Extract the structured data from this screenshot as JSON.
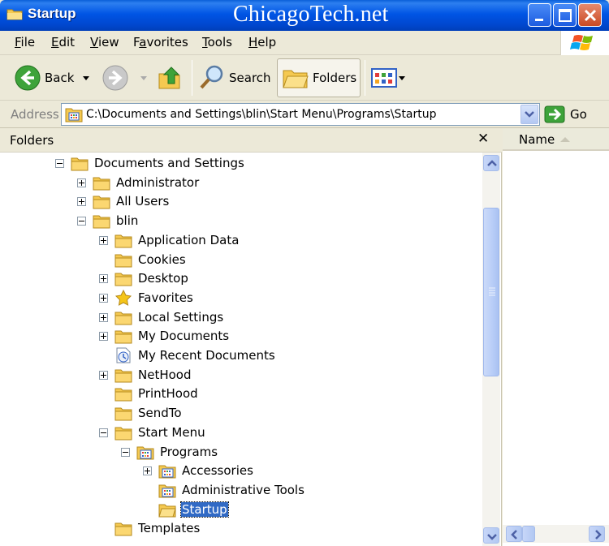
{
  "window": {
    "title": "Startup",
    "watermark": "ChicagoTech.net"
  },
  "menu": {
    "items": [
      {
        "u": "F",
        "rest": "ile"
      },
      {
        "u": "E",
        "rest": "dit"
      },
      {
        "u": "V",
        "rest": "iew"
      },
      {
        "pre": "F",
        "u": "a",
        "rest": "vorites"
      },
      {
        "u": "T",
        "rest": "ools"
      },
      {
        "u": "H",
        "rest": "elp"
      }
    ]
  },
  "toolbar": {
    "back_label": "Back",
    "search_label": "Search",
    "folders_label": "Folders"
  },
  "address": {
    "label": "Address",
    "path": "C:\\Documents and Settings\\blin\\Start Menu\\Programs\\Startup",
    "go_label": "Go"
  },
  "folders_pane": {
    "title": "Folders",
    "close_glyph": "✕"
  },
  "tree": [
    {
      "label": "Documents and Settings",
      "expander": "minus",
      "icon": "folder-icon"
    },
    {
      "label": "Administrator",
      "expander": "plus",
      "icon": "folder-icon"
    },
    {
      "label": "All Users",
      "expander": "plus",
      "icon": "folder-icon"
    },
    {
      "label": "blin",
      "expander": "minus",
      "icon": "folder-icon"
    },
    {
      "label": "Application Data",
      "expander": "plus",
      "icon": "folder-icon"
    },
    {
      "label": "Cookies",
      "expander": "none",
      "icon": "folder-icon"
    },
    {
      "label": "Desktop",
      "expander": "plus",
      "icon": "folder-icon"
    },
    {
      "label": "Favorites",
      "expander": "plus",
      "icon": "star-icon"
    },
    {
      "label": "Local Settings",
      "expander": "plus",
      "icon": "folder-icon"
    },
    {
      "label": "My Documents",
      "expander": "plus",
      "icon": "folder-icon"
    },
    {
      "label": "My Recent Documents",
      "expander": "none",
      "icon": "recent-documents-icon"
    },
    {
      "label": "NetHood",
      "expander": "plus",
      "icon": "folder-icon"
    },
    {
      "label": "PrintHood",
      "expander": "none",
      "icon": "folder-icon"
    },
    {
      "label": "SendTo",
      "expander": "none",
      "icon": "folder-icon"
    },
    {
      "label": "Start Menu",
      "expander": "minus",
      "icon": "folder-icon"
    },
    {
      "label": "Programs",
      "expander": "minus",
      "icon": "programs-folder-icon"
    },
    {
      "label": "Accessories",
      "expander": "plus",
      "icon": "programs-folder-icon"
    },
    {
      "label": "Administrative Tools",
      "expander": "none",
      "icon": "programs-folder-icon"
    },
    {
      "label": "Startup",
      "expander": "none",
      "icon": "open-folder-icon",
      "selected": true
    },
    {
      "label": "Templates",
      "expander": "none",
      "icon": "folder-icon"
    }
  ],
  "details": {
    "column_name": "Name"
  },
  "colors": {
    "titlebar": "#0055e5",
    "selection": "#316ac5",
    "folder": "#f5c951"
  }
}
